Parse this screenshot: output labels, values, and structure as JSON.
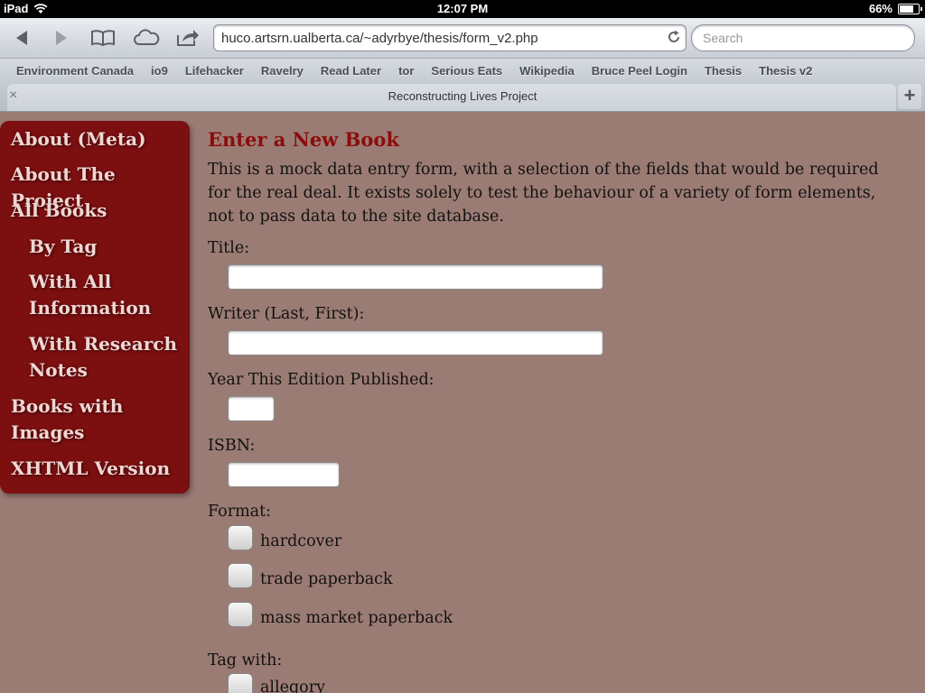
{
  "status": {
    "device": "iPad",
    "time": "12:07 PM",
    "battery": "66%"
  },
  "toolbar": {
    "url": "huco.artsrn.ualberta.ca/~adyrbye/thesis/form_v2.php",
    "search_placeholder": "Search"
  },
  "bookmarks": [
    "Environment Canada",
    "io9",
    "Lifehacker",
    "Ravelry",
    "Read Later",
    "tor",
    "Serious Eats",
    "Wikipedia",
    "Bruce Peel Login",
    "Thesis",
    "Thesis v2"
  ],
  "tab": {
    "title": "Reconstructing Lives Project",
    "close": "×",
    "new": "+"
  },
  "sidebar": {
    "items": [
      {
        "label": "About (Meta)"
      },
      {
        "label": "About The Project"
      },
      {
        "label": "All Books"
      },
      {
        "label": "By Tag"
      },
      {
        "label": "With All Information"
      },
      {
        "label": "With Research Notes"
      },
      {
        "label": "Books with Images"
      },
      {
        "label": "XHTML Version"
      }
    ]
  },
  "form": {
    "heading": "Enter a New Book",
    "intro": "This is a mock data entry form, with a selection of the fields that would be required for the real deal. It exists solely to test the behaviour of a variety of form elements, not to pass data to the site database.",
    "title_label": "Title:",
    "writer_label": "Writer (Last, First):",
    "year_label": "Year This Edition Published:",
    "isbn_label": "ISBN:",
    "format_label": "Format:",
    "formats": [
      "hardcover",
      "trade paperback",
      "mass market paperback"
    ],
    "tag_label": "Tag with:",
    "tags": [
      "allegory"
    ]
  }
}
